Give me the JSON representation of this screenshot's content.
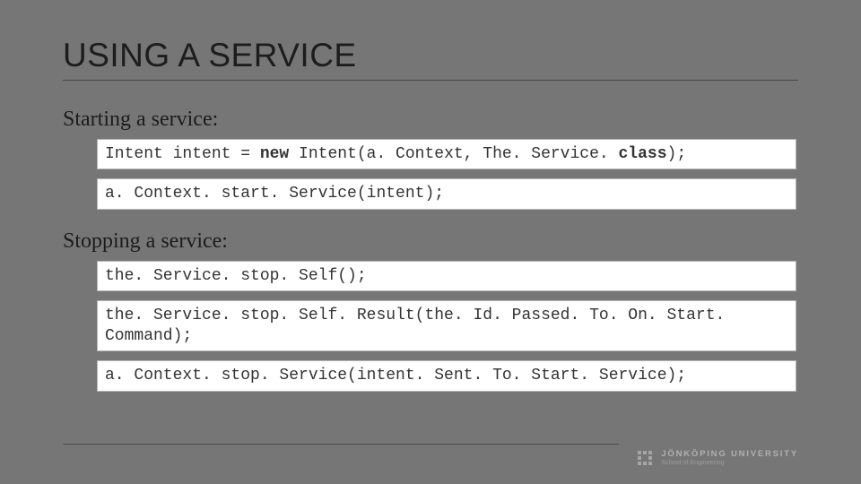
{
  "title": "USING A SERVICE",
  "sections": {
    "start": {
      "label": "Starting a service:"
    },
    "stop": {
      "label": "Stopping a service:"
    }
  },
  "code": {
    "start1_a": "Intent intent = ",
    "start1_kw": "new",
    "start1_b": " Intent(a. Context, The. Service. ",
    "start1_kw2": "class",
    "start1_c": ");",
    "start2": "a. Context. start. Service(intent);",
    "stop1": "the. Service. stop. Self();",
    "stop2": "the. Service. stop. Self. Result(the. Id. Passed. To. On. Start. Command);",
    "stop3": "a. Context. stop. Service(intent. Sent. To. Start. Service);"
  },
  "footer": {
    "line1": "JÖNKÖPING UNIVERSITY",
    "line2": "School of Engineering"
  }
}
